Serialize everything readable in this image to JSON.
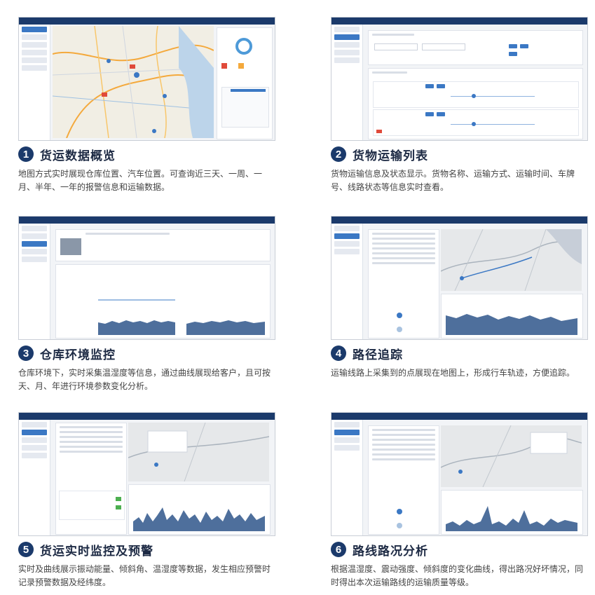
{
  "cards": [
    {
      "num": "1",
      "title": "货运数据概览",
      "desc": "地图方式实时展现仓库位置、汽车位置。可查询近三天、一周、一月、半年、一年的报警信息和运输数据。"
    },
    {
      "num": "2",
      "title": "货物运输列表",
      "desc": "货物运输信息及状态显示。货物名称、运输方式、运输时间、车牌号、线路状态等信息实时查看。"
    },
    {
      "num": "3",
      "title": "仓库环境监控",
      "desc": "仓库环境下，实时采集温湿度等信息，通过曲线展现给客户，且可按天、月、年进行环境参数变化分析。"
    },
    {
      "num": "4",
      "title": "路径追踪",
      "desc": "运输线路上采集到的点展现在地图上，形成行车轨迹，方便追踪。"
    },
    {
      "num": "5",
      "title": "货运实时监控及预警",
      "desc": "实时及曲线展示振动能量、倾斜角、温湿度等数据，发生相应预警时记录预警数据及经纬度。"
    },
    {
      "num": "6",
      "title": "路线路况分析",
      "desc": "根据温湿度、震动强度、倾斜度的变化曲线，得出路况好坏情况，同时得出本次运输路线的运输质量等级。"
    }
  ],
  "colors": {
    "accent": "#1b3a6b",
    "button": "#3b78c4"
  }
}
